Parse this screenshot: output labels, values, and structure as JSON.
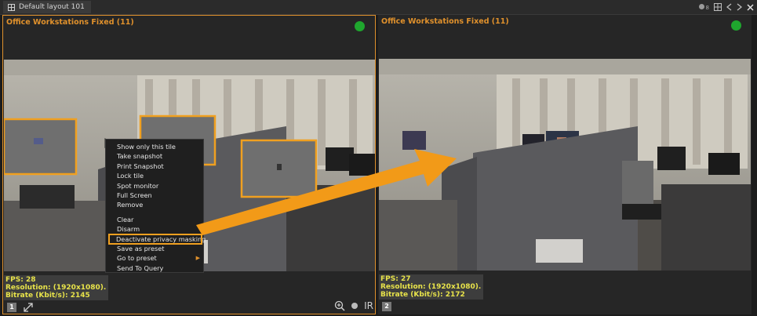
{
  "layout_tab": {
    "label": "Default layout 101"
  },
  "top_right": {
    "count": "8",
    "icons": [
      "camera-count-icon",
      "layout-grid-icon",
      "prev-icon",
      "next-icon",
      "close-icon"
    ]
  },
  "tiles": [
    {
      "title": "Office Workstations Fixed (11)",
      "status_color": "#1fa62e",
      "fps": "FPS: 28",
      "resolution": "Resolution: (1920x1080).",
      "bitrate": "Bitrate (Kbit/s): 2145",
      "number": "1"
    },
    {
      "title": "Office Workstations Fixed (11)",
      "status_color": "#1fa62e",
      "fps": "FPS: 27",
      "resolution": "Resolution: (1920x1080).",
      "bitrate": "Bitrate (Kbit/s): 2172",
      "number": "2"
    }
  ],
  "tile_tools": {
    "ir_label": "IR"
  },
  "context_menu": {
    "items": [
      "Show only this tile",
      "Take snapshot",
      "Print Snapshot",
      "Lock tile",
      "Spot monitor",
      "Full Screen",
      "Remove",
      "Clear",
      "Disarm",
      "Deactivate privacy masking",
      "Save as preset",
      "Go to preset",
      "Send To Query"
    ]
  },
  "colors": {
    "accent": "#e0912c",
    "info_text": "#e8e34a",
    "highlight": "#f0a020",
    "arrow": "#f29a18"
  }
}
